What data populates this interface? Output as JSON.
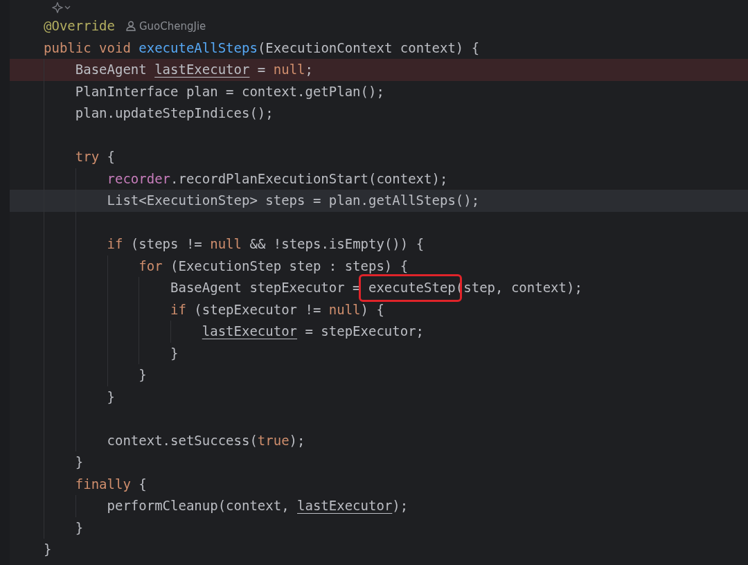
{
  "editor": {
    "lines": [
      {
        "breakpoint": false,
        "current": false,
        "tokens": [
          {
            "text": "@Override",
            "kind": "annotation"
          }
        ],
        "author": "GuoChengJie"
      },
      {
        "breakpoint": false,
        "current": false,
        "tokens": [
          {
            "text": "public void ",
            "kind": "keyword"
          },
          {
            "text": "executeAllSteps",
            "kind": "declaration"
          },
          {
            "text": "(ExecutionContext context) {",
            "kind": "plain"
          }
        ],
        "children": [
          {
            "breakpoint": true,
            "current": false,
            "tokens": [
              {
                "text": "BaseAgent ",
                "kind": "plain"
              },
              {
                "text": "lastExecutor",
                "kind": "reassigned"
              },
              {
                "text": " = ",
                "kind": "plain"
              },
              {
                "text": "null",
                "kind": "keyword"
              },
              {
                "text": ";",
                "kind": "plain"
              }
            ]
          },
          {
            "breakpoint": false,
            "current": false,
            "tokens": [
              {
                "text": "PlanInterface plan = context.getPlan();",
                "kind": "plain"
              }
            ]
          },
          {
            "breakpoint": false,
            "current": false,
            "tokens": [
              {
                "text": "plan.updateStepIndices();",
                "kind": "plain"
              }
            ]
          },
          {
            "breakpoint": false,
            "current": false
          },
          {
            "breakpoint": false,
            "current": false,
            "tokens": [
              {
                "text": "try",
                "kind": "keyword"
              },
              {
                "text": " {",
                "kind": "plain"
              }
            ],
            "children": [
              {
                "breakpoint": false,
                "current": false,
                "tokens": [
                  {
                    "text": "recorder",
                    "kind": "field"
                  },
                  {
                    "text": ".recordPlanExecutionStart(context);",
                    "kind": "plain"
                  }
                ]
              },
              {
                "breakpoint": false,
                "current": true,
                "tokens": [
                  {
                    "text": "List<ExecutionStep> steps = plan.getAllSteps();",
                    "kind": "plain"
                  }
                ]
              },
              {
                "breakpoint": false,
                "current": false
              },
              {
                "breakpoint": false,
                "current": false,
                "tokens": [
                  {
                    "text": "if",
                    "kind": "keyword"
                  },
                  {
                    "text": " (steps != ",
                    "kind": "plain"
                  },
                  {
                    "text": "null",
                    "kind": "keyword"
                  },
                  {
                    "text": " && !steps.isEmpty()) {",
                    "kind": "plain"
                  }
                ],
                "children": [
                  {
                    "breakpoint": false,
                    "current": false,
                    "tokens": [
                      {
                        "text": "for",
                        "kind": "keyword"
                      },
                      {
                        "text": " (ExecutionStep step : steps) {",
                        "kind": "plain"
                      }
                    ],
                    "children": [
                      {
                        "breakpoint": false,
                        "current": false,
                        "tokens": [
                          {
                            "text": "BaseAgent stepExecutor = ",
                            "kind": "plain"
                          },
                          {
                            "text": "executeStep(",
                            "kind": "plain",
                            "boxed": true
                          },
                          {
                            "text": "step, context);",
                            "kind": "plain"
                          }
                        ]
                      },
                      {
                        "breakpoint": false,
                        "current": false,
                        "tokens": [
                          {
                            "text": "if",
                            "kind": "keyword"
                          },
                          {
                            "text": " (stepExecutor != ",
                            "kind": "plain"
                          },
                          {
                            "text": "null",
                            "kind": "keyword"
                          },
                          {
                            "text": ") {",
                            "kind": "plain"
                          }
                        ],
                        "children": [
                          {
                            "breakpoint": false,
                            "current": false,
                            "tokens": [
                              {
                                "text": "lastExecutor",
                                "kind": "reassigned"
                              },
                              {
                                "text": " = stepExecutor;",
                                "kind": "plain"
                              }
                            ]
                          }
                        ]
                      },
                      {
                        "breakpoint": false,
                        "current": false,
                        "tokens": [
                          {
                            "text": "}",
                            "kind": "plain"
                          }
                        ]
                      }
                    ]
                  },
                  {
                    "breakpoint": false,
                    "current": false,
                    "tokens": [
                      {
                        "text": "}",
                        "kind": "plain"
                      }
                    ]
                  }
                ]
              },
              {
                "breakpoint": false,
                "current": false,
                "tokens": [
                  {
                    "text": "}",
                    "kind": "plain"
                  }
                ]
              },
              {
                "breakpoint": false,
                "current": false
              },
              {
                "breakpoint": false,
                "current": false,
                "tokens": [
                  {
                    "text": "context.setSuccess(",
                    "kind": "plain"
                  },
                  {
                    "text": "true",
                    "kind": "keyword"
                  },
                  {
                    "text": ");",
                    "kind": "plain"
                  }
                ]
              }
            ]
          },
          {
            "breakpoint": false,
            "current": false,
            "tokens": [
              {
                "text": "}",
                "kind": "plain"
              }
            ]
          },
          {
            "breakpoint": false,
            "current": false,
            "tokens": [
              {
                "text": "finally",
                "kind": "keyword"
              },
              {
                "text": " {",
                "kind": "plain"
              }
            ],
            "children": [
              {
                "breakpoint": false,
                "current": false,
                "tokens": [
                  {
                    "text": "performCleanup(context, ",
                    "kind": "plain"
                  },
                  {
                    "text": "lastExecutor",
                    "kind": "reassigned"
                  },
                  {
                    "text": ");",
                    "kind": "plain"
                  }
                ]
              }
            ]
          },
          {
            "breakpoint": false,
            "current": false,
            "tokens": [
              {
                "text": "}",
                "kind": "plain"
              }
            ]
          }
        ]
      },
      {
        "breakpoint": false,
        "current": false,
        "tokens": [
          {
            "text": "}",
            "kind": "plain"
          }
        ]
      }
    ]
  }
}
